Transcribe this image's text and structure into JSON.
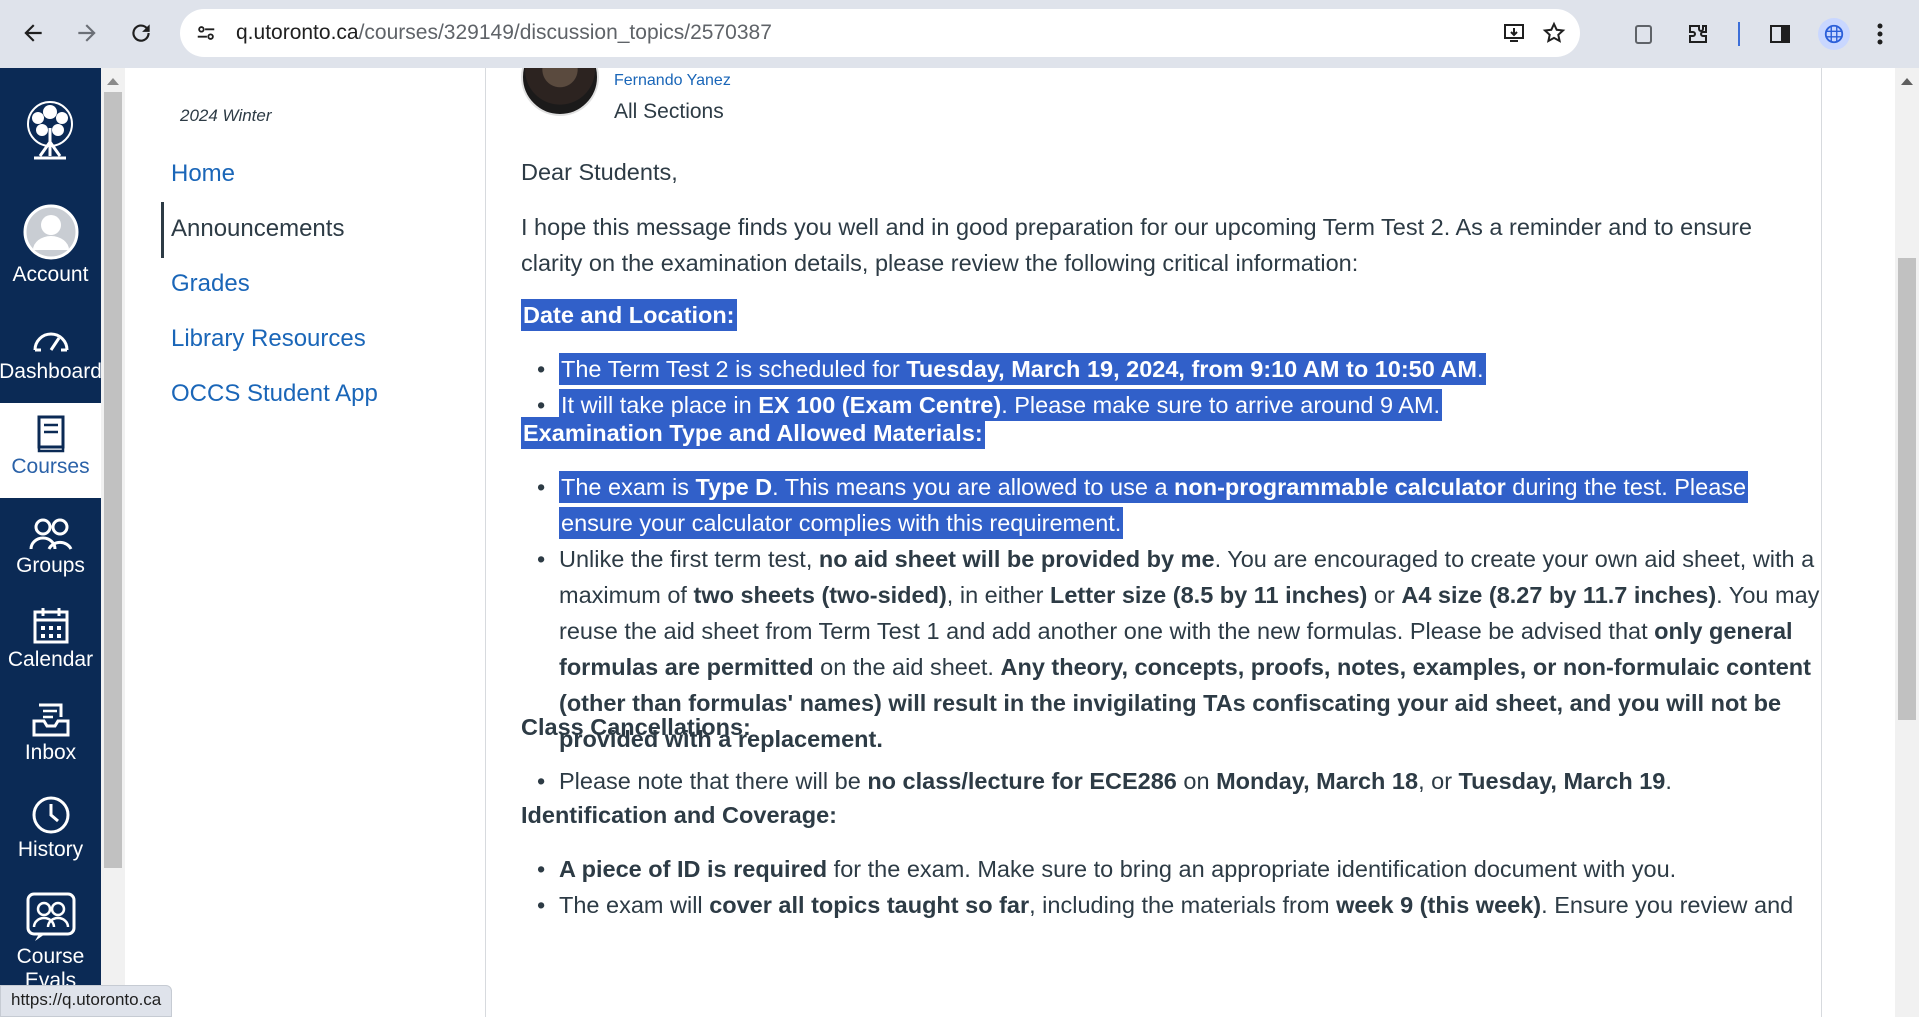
{
  "browser": {
    "url_host": "q.utoronto.ca",
    "url_path": "/courses/329149/discussion_topics/2570387",
    "status_url": "https://q.utoronto.ca"
  },
  "global_nav": [
    {
      "label": "Account",
      "icon": "account-avatar-icon"
    },
    {
      "label": "Dashboard",
      "icon": "dashboard-gauge-icon"
    },
    {
      "label": "Courses",
      "icon": "courses-book-icon"
    },
    {
      "label": "Groups",
      "icon": "groups-icon"
    },
    {
      "label": "Calendar",
      "icon": "calendar-icon"
    },
    {
      "label": "Inbox",
      "icon": "inbox-icon"
    },
    {
      "label": "History",
      "icon": "history-clock-icon"
    },
    {
      "label": "Course Evals",
      "icon": "course-evals-icon"
    }
  ],
  "course_nav": {
    "term": "2024 Winter",
    "links": [
      "Home",
      "Announcements",
      "Grades",
      "Library Resources",
      "OCCS Student App"
    ],
    "active": "Announcements"
  },
  "post": {
    "author": "Fernando Yanez",
    "sections": "All Sections",
    "greeting": "Dear Students,",
    "intro": "I hope this message finds you well and in good preparation for our upcoming Term Test 2. As a reminder and to ensure clarity on the examination details, please review the following critical information:",
    "h_date": "Date and Location:",
    "date_1a": "The Term Test 2 is scheduled for ",
    "date_1b": "Tuesday, March 19, 2024, from 9:10 AM to 10:50 AM",
    "date_1c": ".",
    "date_2a": "It will take place in ",
    "date_2b": "EX 100 (Exam Centre)",
    "date_2c": ". Please make sure to arrive around 9 AM.",
    "h_exam": "Examination Type and Allowed Materials:",
    "exam_1a": "The exam is ",
    "exam_1b": "Type D",
    "exam_1c": ". This means you are allowed to use a ",
    "exam_1d": "non-programmable calculator",
    "exam_1e": " during the test. Please",
    "exam_1f": "ensure your calculator complies with this requirement.",
    "aid_a": "Unlike the first term test, ",
    "aid_b": "no aid sheet will be provided by me",
    "aid_c": ". You are encouraged to create your own aid sheet, with a maximum of ",
    "aid_d": "two sheets (two-sided)",
    "aid_e": ", in either ",
    "aid_f": "Letter size (8.5 by 11 inches)",
    "aid_g": " or ",
    "aid_h": "A4 size (8.27 by 11.7 inches)",
    "aid_i": ". You may reuse the aid sheet from Term Test 1 and add another one with the new formulas. Please be advised that ",
    "aid_j": "only general formulas are permitted",
    "aid_k": " on the aid sheet. ",
    "aid_l": "Any theory, concepts, proofs, notes, examples, or non-formulaic content (other than formulas' names) will result in the invigilating TAs confiscating your aid sheet, and you will not be provided with a replacement.",
    "h_cancel": "Class Cancellations:",
    "cancel_a": "Please note that there will be ",
    "cancel_b": "no class/lecture for ECE286",
    "cancel_c": " on ",
    "cancel_d": "Monday, March 18",
    "cancel_e": ", or ",
    "cancel_f": "Tuesday, March 19",
    "cancel_g": ".",
    "h_id": "Identification and Coverage:",
    "id_a": "A piece of ID is required",
    "id_b": " for the exam. Make sure to bring an appropriate identification document with you.",
    "cov_a": "The exam will ",
    "cov_b": "cover all topics taught so far",
    "cov_c": ", including the materials from ",
    "cov_d": "week 9 (this week)",
    "cov_e": ". Ensure you review and"
  },
  "colors": {
    "nav_bg": "#0b2a55",
    "link": "#1a66b8",
    "selection": "#3160c9"
  }
}
